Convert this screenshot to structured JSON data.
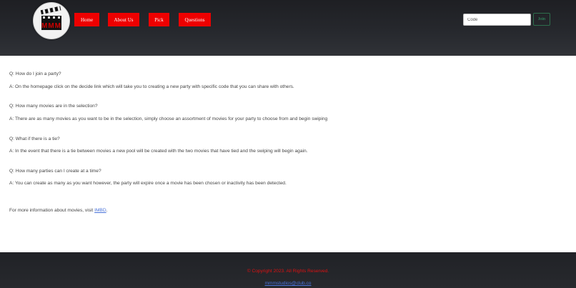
{
  "header": {
    "logo": {
      "icon": "clapperboard-icon",
      "letters": "MMM"
    },
    "nav": [
      {
        "label": "Home"
      },
      {
        "label": "About Us"
      },
      {
        "label": "Pick"
      },
      {
        "label": "Questions"
      }
    ],
    "code_input": {
      "value": "",
      "placeholder": "Code"
    },
    "join_label": "Join"
  },
  "faq": [
    {
      "question": "Q: How do I join a party?",
      "answer": "A: On the homepage click on the decide link which will take you to creating a new party with specific code that you can share with others."
    },
    {
      "question": "Q: How many movies are in the selection?",
      "answer": "A: There are as many movies as you want to be in the selection, simply choose an assortment of movies for your party to choose from and begin swiping"
    },
    {
      "question": "Q: What if there is a tie?",
      "answer": "A: In the event that there is a tie between movies a new pool will be created with the two movies that have tied and the swiping will begin again."
    },
    {
      "question": "Q: How many parties can I create at a time?",
      "answer": "A: You can create as many as you want however, the party will expire once a movie has been chosen or inactivity has been detected."
    }
  ],
  "more_info": {
    "prefix": "For more information about movies, visit ",
    "link_text": "IMBD",
    "suffix": "."
  },
  "footer": {
    "copyright": "© Copyright 2023. All Rights Reserved.",
    "email": "mmmstudios@club.co"
  },
  "colors": {
    "accent": "#ee0000",
    "header_bg": "#26282d",
    "join_green": "#34a36a",
    "link": "#4a73d9"
  }
}
